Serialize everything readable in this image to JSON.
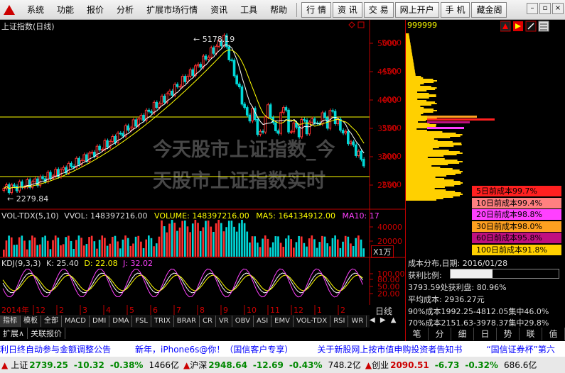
{
  "menu": {
    "items": [
      "系统",
      "功能",
      "报价",
      "分析",
      "扩展市场行情",
      "资讯",
      "工具",
      "帮助"
    ],
    "tools": [
      "行 情",
      "资 讯",
      "交 易",
      "网上开户",
      "手 机",
      "藏金阁"
    ]
  },
  "chart": {
    "title": "上证指数(日线)",
    "high_label": "5178.19",
    "low_label": "2279.84",
    "y_ticks": [
      "5000",
      "4500",
      "4000",
      "3500",
      "3000",
      "2500"
    ],
    "time_labels": [
      "2014年",
      "12",
      "2",
      "3",
      "4",
      "5",
      "6",
      "7",
      "8",
      "9",
      "10",
      "11",
      "12",
      "1",
      "2"
    ]
  },
  "volume": {
    "label": "VOL-TDX(5,10)",
    "vol_label": "VVOL:",
    "vol_value": "148397216.00",
    "volume_label": "VOLUME:",
    "volume_value": "148397216.00",
    "ma5_label": "MA5:",
    "ma5_value": "164134912.00",
    "ma10_label": "MA10:",
    "ma10_value": "17",
    "y_ticks": [
      "40000",
      "20000"
    ],
    "unit": "X1万"
  },
  "kdj": {
    "label": "KDJ(9,3,3)",
    "k": "K: 25.40",
    "d": "D: 22.08",
    "j": "J: 32.02",
    "y_ticks": [
      "100.00",
      "80.00",
      "50.00",
      "20.00"
    ]
  },
  "indicator_tabs": [
    "指标",
    "模板",
    "全部",
    "MACD",
    "DMI",
    "DMA",
    "FSL",
    "TRIX",
    "BRAR",
    "CR",
    "VR",
    "OBV",
    "ASI",
    "EMV",
    "VOL-TDX",
    "RSI",
    "WR"
  ],
  "period_label": "日线",
  "bottom_tabs": [
    "扩展∧",
    "关联报价"
  ],
  "right_panel": {
    "code": "999999",
    "y_ticks": [
      "5000",
      "4500",
      "4000",
      "3500",
      "3000",
      "2500"
    ],
    "legend": [
      {
        "text": "5日前成本99.7%",
        "color": "#ff2020"
      },
      {
        "text": "10日前成本99.4%",
        "color": "#ff8080"
      },
      {
        "text": "20日前成本98.8%",
        "color": "#ff40ff"
      },
      {
        "text": "30日前成本98.0%",
        "color": "#ffa020"
      },
      {
        "text": "60日前成本95.8%",
        "color": "#c01080"
      },
      {
        "text": "100日前成本91.8%",
        "color": "#ffd000"
      }
    ],
    "cost_date_label": "成本分布,日期:",
    "cost_date": "2016/01/28",
    "profit_label": "获利比例:",
    "profit_value": "38.6%",
    "profit_line": "3793.59处获利盘: 80.96%",
    "avg_cost_line": "平均成本:    2936.27元",
    "c90_line": "90%成本1992.25-4812.05集中46.0%",
    "c70_line": "70%成本2151.63-3978.37集中29.8%",
    "nav": [
      "笔",
      "分",
      "细",
      "日",
      "势",
      "联",
      "值"
    ]
  },
  "ticker": [
    "利日终自动参与金额调整公告",
    "新年，iPhone6s@你！（国信客户专享）",
    "关于新股网上按市值申购投资者告知书",
    "“国信证券杯”第六"
  ],
  "status": {
    "sh_label": "上证",
    "sh_value": "2739.25",
    "sh_change": "-10.32",
    "sh_pct": "-0.38%",
    "sh_amount": "1466亿",
    "sz_label": "沪深",
    "sz_value": "2948.64",
    "sz_change": "-12.69",
    "sz_pct": "-0.43%",
    "sz_amount": "748.2亿",
    "cy_label": "创业",
    "cy_value": "2090.51",
    "cy_change": "-6.73",
    "cy_pct": "-0.32%",
    "cy_amount": "686.6亿"
  },
  "watermark": [
    "今天股市上证指数_今",
    "天股市上证指数实时"
  ],
  "colors": {
    "up": "#ff3030",
    "down": "#00d8d8",
    "accent": "#b00000",
    "price_line": "#ffff00"
  }
}
